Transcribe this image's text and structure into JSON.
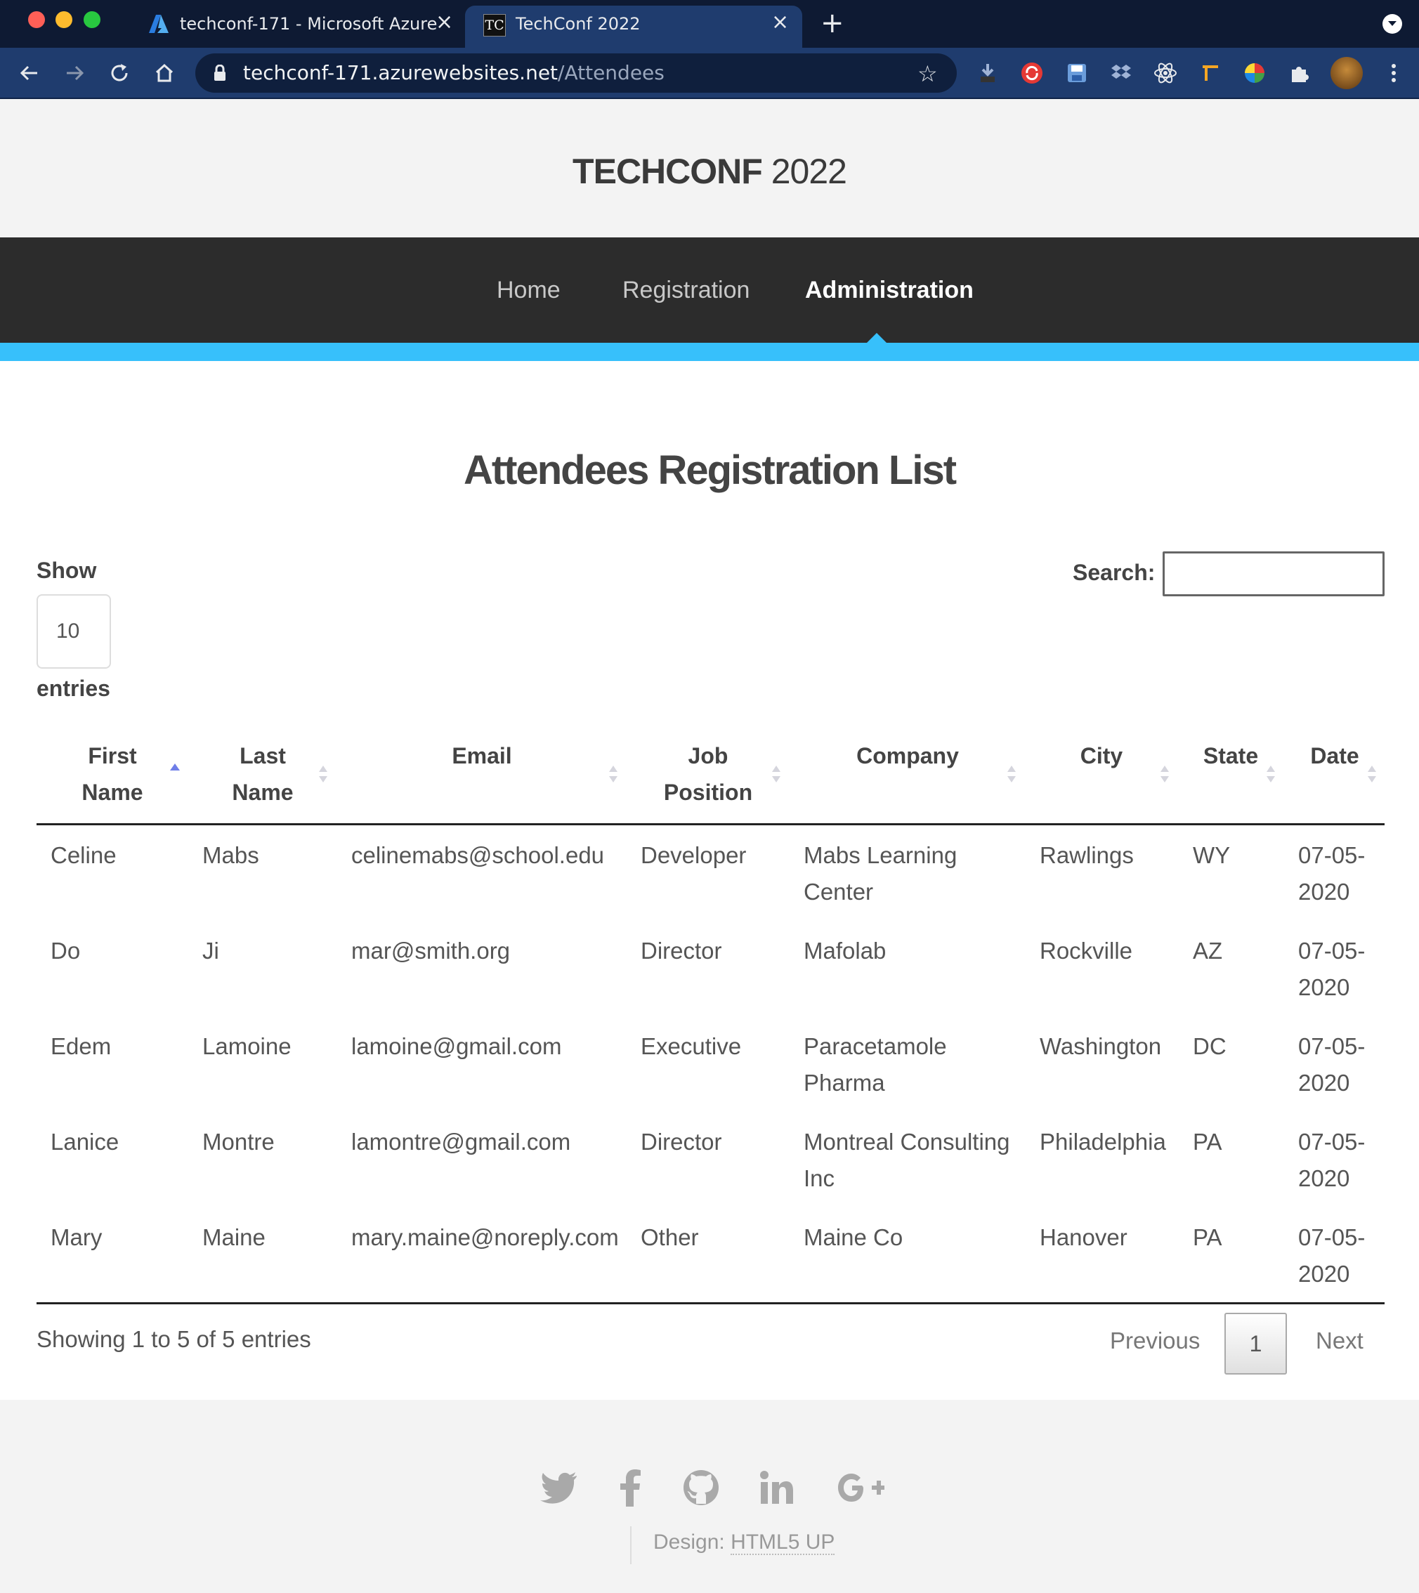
{
  "browser": {
    "tabs": [
      {
        "title": "techconf-171 - Microsoft Azure"
      },
      {
        "title": "TechConf 2022",
        "favicon_text": "TC"
      }
    ],
    "url_host": "techconf-171.azurewebsites.net",
    "url_path": "/Attendees"
  },
  "site": {
    "brand_bold": "TECHCONF",
    "brand_year": "2022",
    "nav": [
      "Home",
      "Registration",
      "Administration"
    ],
    "active_nav": "Administration"
  },
  "page": {
    "title": "Attendees Registration List",
    "show_label": "Show",
    "entries_label": "entries",
    "length_value": "10",
    "search_label": "Search:",
    "search_value": ""
  },
  "table": {
    "columns": [
      {
        "line1": "First",
        "line2": "Name",
        "sort": "asc"
      },
      {
        "line1": "Last",
        "line2": "Name",
        "sort": "none"
      },
      {
        "line1": "Email",
        "line2": "",
        "sort": "none"
      },
      {
        "line1": "Job",
        "line2": "Position",
        "sort": "none"
      },
      {
        "line1": "Company",
        "line2": "",
        "sort": "none"
      },
      {
        "line1": "City",
        "line2": "",
        "sort": "none"
      },
      {
        "line1": "State",
        "line2": "",
        "sort": "none"
      },
      {
        "line1": "Date",
        "line2": "",
        "sort": "none"
      }
    ],
    "rows": [
      {
        "first": "Celine",
        "last": "Mabs",
        "email": "celinemabs@school.edu",
        "job": "Developer",
        "company_1": "Mabs Learning",
        "company_2": "Center",
        "city": "Rawlings",
        "state": "WY",
        "date_1": "07-05-",
        "date_2": "2020"
      },
      {
        "first": "Do",
        "last": "Ji",
        "email": "mar@smith.org",
        "job": "Director",
        "company_1": "Mafolab",
        "company_2": "",
        "city": "Rockville",
        "state": "AZ",
        "date_1": "07-05-",
        "date_2": "2020"
      },
      {
        "first": "Edem",
        "last": "Lamoine",
        "email": "lamoine@gmail.com",
        "job": "Executive",
        "company_1": "Paracetamole",
        "company_2": "Pharma",
        "city": "Washington",
        "state": "DC",
        "date_1": "07-05-",
        "date_2": "2020"
      },
      {
        "first": "Lanice",
        "last": "Montre",
        "email": "lamontre@gmail.com",
        "job": "Director",
        "company_1": "Montreal Consulting",
        "company_2": "Inc",
        "city": "Philadelphia",
        "state": "PA",
        "date_1": "07-05-",
        "date_2": "2020"
      },
      {
        "first": "Mary",
        "last": "Maine",
        "email": "mary.maine@noreply.com",
        "job": "Other",
        "company_1": "Maine Co",
        "company_2": "",
        "city": "Hanover",
        "state": "PA",
        "date_1": "07-05-",
        "date_2": "2020"
      }
    ]
  },
  "pagination": {
    "info": "Showing 1 to 5 of 5 entries",
    "previous": "Previous",
    "current_page": "1",
    "next": "Next"
  },
  "footer": {
    "social_icons": [
      "twitter-icon",
      "facebook-icon",
      "github-icon",
      "linkedin-icon",
      "google-plus-icon"
    ],
    "credit_prefix": "Design: ",
    "credit_link": "HTML5 UP"
  },
  "colors": {
    "accent": "#37c0fb",
    "nav_bg": "#2c2c2c",
    "chrome_tabbar": "#0e1a33",
    "chrome_toolbar": "#1f3c6e"
  }
}
